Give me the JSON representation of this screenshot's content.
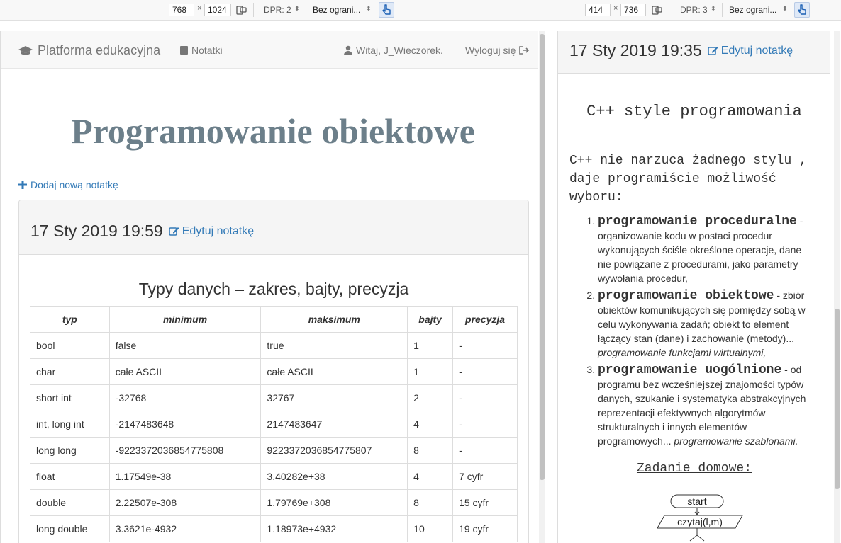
{
  "toolbar": {
    "left": {
      "width": "768",
      "height": "1024",
      "dpr": "DPR: 2",
      "throttle": "Bez ograni..."
    },
    "right": {
      "width": "414",
      "height": "736",
      "dpr": "DPR: 3",
      "throttle": "Bez ograni..."
    },
    "times": "×"
  },
  "navbar": {
    "brand": "Platforma edukacyjna",
    "notes": "Notatki",
    "greeting": "Witaj, J_Wieczorek.",
    "logout": "Wyloguj się"
  },
  "page": {
    "title": "Programowanie obiektowe",
    "add_note": "Dodaj nową notatkę"
  },
  "note1": {
    "date": "17 Sty 2019 19:59",
    "edit": "Edytuj notatkę",
    "heading": "Typy danych – zakres, bajty, precyzja",
    "columns": [
      "typ",
      "minimum",
      "maksimum",
      "bajty",
      "precyzja"
    ],
    "rows": [
      [
        "bool",
        "false",
        "true",
        "1",
        "-"
      ],
      [
        "char",
        "całe ASCII",
        "całe ASCII",
        "1",
        "-"
      ],
      [
        "short int",
        "-32768",
        "32767",
        "2",
        "-"
      ],
      [
        "int, long int",
        "-2147483648",
        "2147483647",
        "4",
        "-"
      ],
      [
        "long long",
        "-9223372036854775808",
        "9223372036854775807",
        "8",
        "-"
      ],
      [
        "float",
        "1.17549e-38",
        "3.40282e+38",
        "4",
        "7 cyfr"
      ],
      [
        "double",
        "2.22507e-308",
        "1.79769e+308",
        "8",
        "15 cyfr"
      ],
      [
        "long double",
        "3.3621e-4932",
        "1.18973e+4932",
        "10",
        "19 cyfr"
      ]
    ]
  },
  "note2": {
    "date": "17 Sty 2019 19:35",
    "edit": "Edytuj notatkę",
    "title": "C++ style programowania",
    "intro": "C++ nie narzuca żadnego stylu , daje programiście możliwość wyboru:",
    "items": [
      {
        "term": "programowanie proceduralne",
        "text": " - organizowanie kodu w postaci procedur wykonujących ściśle określone operacje, dane nie powiązane z procedurami, jako parametry wywołania procedur,",
        "em": ""
      },
      {
        "term": "programowanie obiektowe",
        "text": " - zbiór obiektów komunikujących się pomiędzy sobą w celu wykonywania zadań; obiekt to element łączący stan (dane) i zachowanie (metody)... ",
        "em": "programowanie funkcjami wirtualnymi,"
      },
      {
        "term": "programowanie uogólnione",
        "text": " - od programu bez wcześniejszej znajomości typów danych, szukanie i systematyka abstrakcyjnych reprezentacji efektywnych algorytmów strukturalnych i innych elementów programowych... ",
        "em": "programowanie szablonami."
      }
    ],
    "homework": "Zadanie domowe:",
    "flow_start": "start",
    "flow_read": "czytaj(l,m)"
  }
}
